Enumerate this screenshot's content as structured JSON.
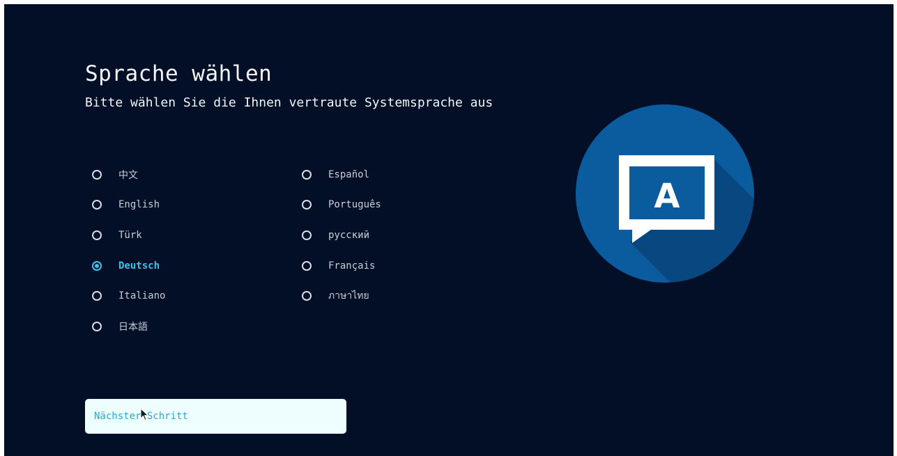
{
  "header": {
    "title": "Sprache wählen",
    "subtitle": "Bitte wählen Sie die Ihnen vertraute Systemsprache aus"
  },
  "languages": {
    "left": [
      {
        "label": "中文",
        "selected": false
      },
      {
        "label": "English",
        "selected": false
      },
      {
        "label": "Türk",
        "selected": false
      },
      {
        "label": "Deutsch",
        "selected": true
      },
      {
        "label": "Italiano",
        "selected": false
      },
      {
        "label": "日本語",
        "selected": false
      }
    ],
    "right": [
      {
        "label": "Español",
        "selected": false
      },
      {
        "label": "Português",
        "selected": false
      },
      {
        "label": "русский",
        "selected": false
      },
      {
        "label": "Français",
        "selected": false
      },
      {
        "label": "ภาษาไทย",
        "selected": false
      }
    ]
  },
  "logo": {
    "letter": "A",
    "icon": "language-chat-bubble-icon"
  },
  "footer": {
    "next_label": "Nächster Schritt"
  },
  "colors": {
    "background": "#020f27",
    "accent": "#3fc1e6",
    "logo_circle": "#0b5b9f",
    "button_bg": "#eefdfd"
  }
}
